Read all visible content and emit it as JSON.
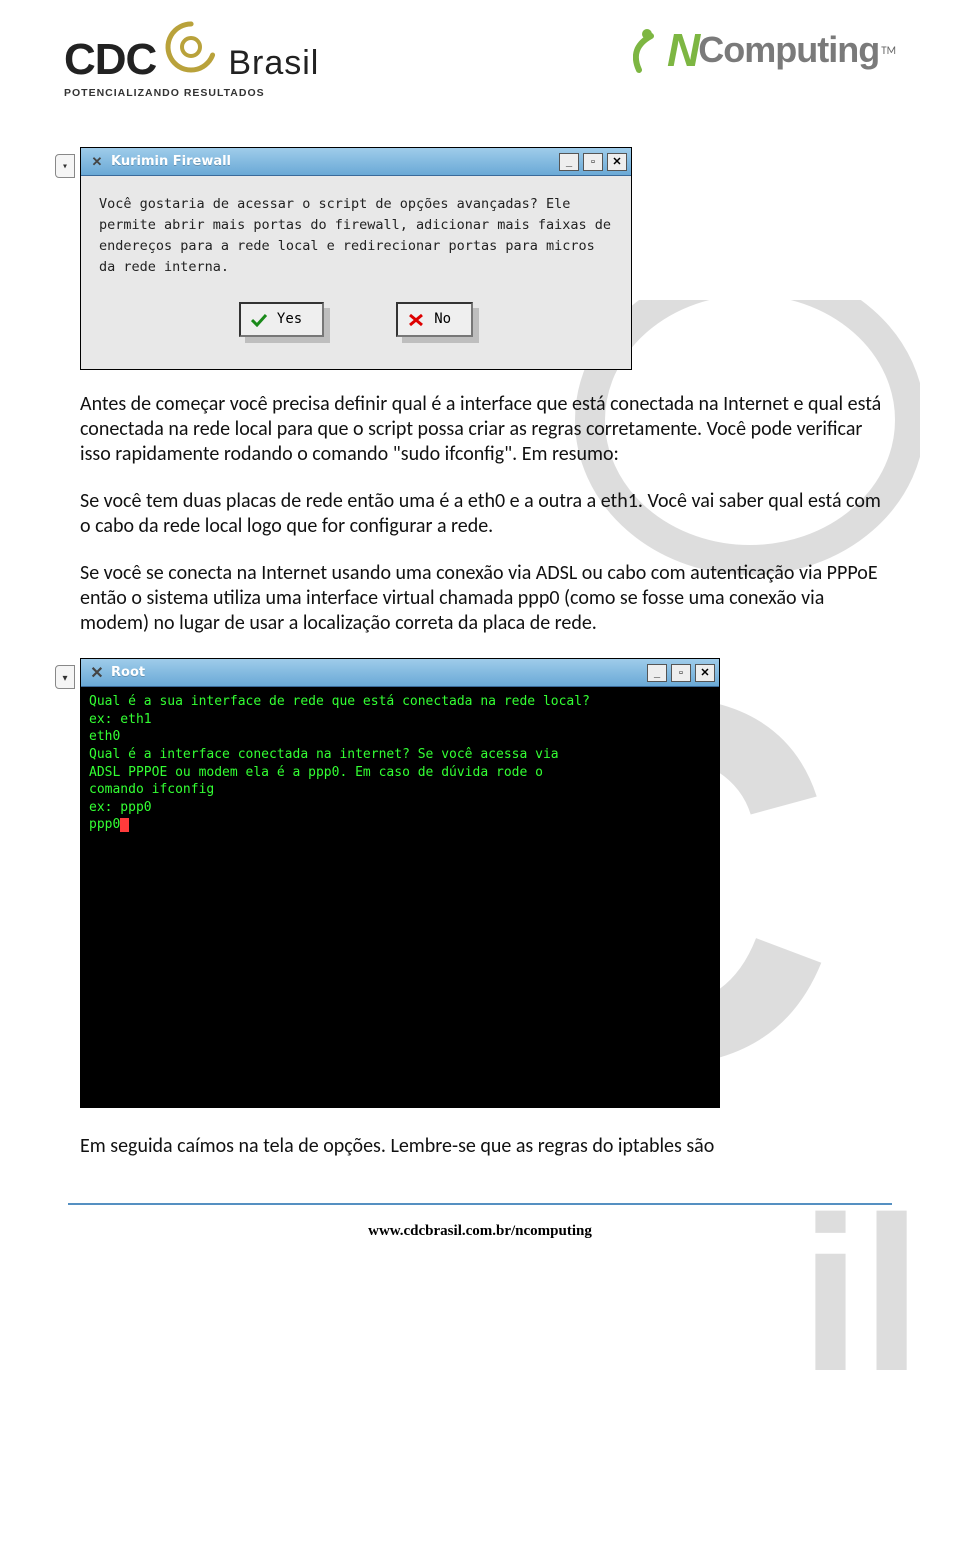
{
  "header": {
    "cdc_text": "CDC",
    "cdc_brasil": "Brasil",
    "cdc_sub": "POTENCIALIZANDO RESULTADOS",
    "ncomp_n": "N",
    "ncomp_rest": "Computing",
    "ncomp_tm": "TM"
  },
  "dialog": {
    "title": "Kurimin Firewall",
    "body": "Você gostaria de acessar o script de opções avançadas? Ele permite abrir mais portas do firewall, adicionar mais faixas de endereços para a rede local e redirecionar portas para micros da rede interna.",
    "yes": "Yes",
    "no": "No",
    "min": "_",
    "max": "▫",
    "close": "✕"
  },
  "paragraphs": {
    "p1": "Antes de começar você precisa definir qual é a interface que está conectada na Internet e qual está conectada na rede local para que o script possa criar as regras corretamente. Você pode verificar isso rapidamente rodando o comando \"sudo ifconfig\". Em resumo:",
    "p2": "Se você tem duas placas de rede então uma é a eth0 e a outra a eth1. Você vai saber qual está com o cabo da rede local logo que for configurar a rede.",
    "p3": "Se você se conecta na Internet usando uma conexão via ADSL ou cabo com autenticação via PPPoE então o sistema utiliza uma interface virtual chamada ppp0 (como se fosse uma conexão via modem) no lugar de usar a localização correta da placa de rede.",
    "p4": "Em seguida caímos na tela de opções. Lembre-se que as regras do iptables são"
  },
  "terminal": {
    "title": "Root",
    "min": "_",
    "max": "▫",
    "close": "✕",
    "lines": [
      "Qual é a sua interface de rede que está conectada na rede local?",
      "ex: eth1",
      "eth0",
      "Qual é a interface conectada na internet? Se você acessa via",
      "ADSL PPPOE ou modem ela é a ppp0. Em caso de dúvida rode o",
      "comando ifconfig",
      "ex: ppp0",
      "ppp0"
    ]
  },
  "footer": {
    "url": "www.cdcbrasil.com.br/ncomputing"
  }
}
